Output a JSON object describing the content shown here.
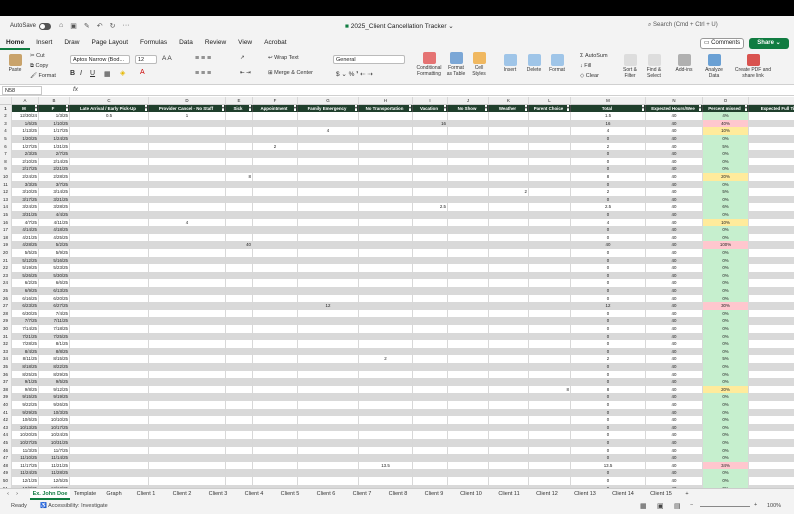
{
  "app": {
    "autosave": "AutoSave",
    "title": "2025_Client Cancellation Tracker",
    "search_placeholder": "Search (Cmd + Ctrl + U)"
  },
  "menu": [
    "Home",
    "Insert",
    "Draw",
    "Page Layout",
    "Formulas",
    "Data",
    "Review",
    "View",
    "Acrobat"
  ],
  "comments_label": "Comments",
  "share_label": "Share",
  "ribbon": {
    "paste": "Paste",
    "cut": "Cut",
    "copy": "Copy",
    "format": "Format",
    "font_name": "Aptos Narrow (Bod...",
    "font_size": "12",
    "wrap_text": "Wrap Text",
    "merge_center": "Merge & Center",
    "number_format": "General",
    "conditional": "Conditional Formatting",
    "format_table": "Format as Table",
    "cell_styles": "Cell Styles",
    "insert": "Insert",
    "delete": "Delete",
    "format2": "Format",
    "autosum": "AutoSum",
    "fill": "Fill",
    "clear": "Clear",
    "sort_filter": "Sort & Filter",
    "find_select": "Find & Select",
    "addins": "Add-ins",
    "analyze": "Analyze Data",
    "create_pdf": "Create PDF and share link"
  },
  "name_box": "N58",
  "fx": "fx",
  "col_letters": [
    "A",
    "B",
    "C",
    "D",
    "E",
    "F",
    "G",
    "H",
    "I",
    "J",
    "K",
    "L",
    "M",
    "N",
    "O",
    ""
  ],
  "headers": [
    "M",
    "F",
    "Late Arrival / Early Pick-Up",
    "Provider Cancel - No Staff",
    "Sick",
    "Appointment",
    "Family Emergency",
    "No Transportation",
    "Vacation",
    "No Show",
    "Weather",
    "Parent Choice",
    "Total",
    "Expected Hours/Wee",
    "Percent missed",
    "Expected Full Ti"
  ],
  "rows": [
    {
      "n": "2",
      "a": "12/30/24",
      "b": "1/3/25",
      "c": "0.5",
      "d": "1",
      "e": "",
      "g": "",
      "h": "",
      "i": "",
      "k": "",
      "l": "",
      "total": "1.5",
      "exp": "40",
      "pct": "4%",
      "lvl": "g"
    },
    {
      "n": "3",
      "a": "1/6/25",
      "b": "1/10/25",
      "c": "",
      "d": "",
      "e": "",
      "g": "",
      "h": "",
      "i": "16",
      "k": "",
      "l": "",
      "total": "16",
      "exp": "40",
      "pct": "40%",
      "lvl": "r"
    },
    {
      "n": "4",
      "a": "1/13/25",
      "b": "1/17/25",
      "c": "",
      "d": "",
      "e": "",
      "g": "4",
      "h": "",
      "i": "",
      "k": "",
      "l": "",
      "total": "4",
      "exp": "40",
      "pct": "10%",
      "lvl": "y"
    },
    {
      "n": "5",
      "a": "1/20/25",
      "b": "1/24/25",
      "c": "",
      "d": "",
      "e": "",
      "g": "",
      "h": "",
      "i": "",
      "k": "",
      "l": "",
      "total": "0",
      "exp": "40",
      "pct": "0%",
      "lvl": "g"
    },
    {
      "n": "6",
      "a": "1/27/25",
      "b": "1/31/25",
      "c": "",
      "d": "",
      "e": "",
      "f": "2",
      "g": "",
      "h": "",
      "i": "",
      "k": "",
      "l": "",
      "total": "2",
      "exp": "40",
      "pct": "5%",
      "lvl": "g"
    },
    {
      "n": "7",
      "a": "2/3/25",
      "b": "2/7/25",
      "total": "0",
      "exp": "40",
      "pct": "0%",
      "lvl": "g"
    },
    {
      "n": "8",
      "a": "2/10/25",
      "b": "2/14/25",
      "total": "0",
      "exp": "40",
      "pct": "0%",
      "lvl": "g"
    },
    {
      "n": "9",
      "a": "2/17/25",
      "b": "2/21/25",
      "total": "0",
      "exp": "40",
      "pct": "0%",
      "lvl": "g"
    },
    {
      "n": "10",
      "a": "2/24/25",
      "b": "2/28/25",
      "e": "8",
      "total": "8",
      "exp": "40",
      "pct": "20%",
      "lvl": "y"
    },
    {
      "n": "11",
      "a": "3/3/25",
      "b": "3/7/25",
      "total": "0",
      "exp": "40",
      "pct": "0%",
      "lvl": "g"
    },
    {
      "n": "12",
      "a": "3/10/25",
      "b": "3/14/25",
      "k": "2",
      "total": "2",
      "exp": "40",
      "pct": "5%",
      "lvl": "g"
    },
    {
      "n": "13",
      "a": "3/17/25",
      "b": "3/21/25",
      "total": "0",
      "exp": "40",
      "pct": "0%",
      "lvl": "g"
    },
    {
      "n": "14",
      "a": "3/24/25",
      "b": "3/28/25",
      "i": "2.5",
      "total": "2.5",
      "exp": "40",
      "pct": "6%",
      "lvl": "g"
    },
    {
      "n": "15",
      "a": "3/31/25",
      "b": "4/4/25",
      "total": "0",
      "exp": "40",
      "pct": "0%",
      "lvl": "g"
    },
    {
      "n": "16",
      "a": "4/7/25",
      "b": "4/11/25",
      "d": "4",
      "total": "4",
      "exp": "40",
      "pct": "10%",
      "lvl": "y"
    },
    {
      "n": "17",
      "a": "4/14/25",
      "b": "4/18/25",
      "total": "0",
      "exp": "40",
      "pct": "0%",
      "lvl": "g"
    },
    {
      "n": "18",
      "a": "4/21/25",
      "b": "4/25/25",
      "total": "0",
      "exp": "40",
      "pct": "0%",
      "lvl": "g"
    },
    {
      "n": "19",
      "a": "4/28/25",
      "b": "5/2/25",
      "e": "40",
      "total": "40",
      "exp": "40",
      "pct": "100%",
      "lvl": "r"
    },
    {
      "n": "20",
      "a": "5/5/25",
      "b": "5/9/25",
      "total": "0",
      "exp": "40",
      "pct": "0%",
      "lvl": "g"
    },
    {
      "n": "21",
      "a": "5/12/25",
      "b": "5/16/25",
      "total": "0",
      "exp": "40",
      "pct": "0%",
      "lvl": "g"
    },
    {
      "n": "22",
      "a": "5/19/25",
      "b": "5/23/25",
      "total": "0",
      "exp": "40",
      "pct": "0%",
      "lvl": "g"
    },
    {
      "n": "23",
      "a": "5/26/25",
      "b": "5/30/25",
      "total": "0",
      "exp": "40",
      "pct": "0%",
      "lvl": "g"
    },
    {
      "n": "24",
      "a": "6/2/25",
      "b": "6/6/25",
      "total": "0",
      "exp": "40",
      "pct": "0%",
      "lvl": "g"
    },
    {
      "n": "25",
      "a": "6/9/25",
      "b": "6/13/25",
      "total": "0",
      "exp": "40",
      "pct": "0%",
      "lvl": "g"
    },
    {
      "n": "26",
      "a": "6/16/25",
      "b": "6/20/25",
      "total": "0",
      "exp": "40",
      "pct": "0%",
      "lvl": "g"
    },
    {
      "n": "27",
      "a": "6/23/25",
      "b": "6/27/25",
      "g": "12",
      "total": "12",
      "exp": "40",
      "pct": "30%",
      "lvl": "r"
    },
    {
      "n": "28",
      "a": "6/30/25",
      "b": "7/4/25",
      "total": "0",
      "exp": "40",
      "pct": "0%",
      "lvl": "g"
    },
    {
      "n": "29",
      "a": "7/7/25",
      "b": "7/11/25",
      "total": "0",
      "exp": "40",
      "pct": "0%",
      "lvl": "g"
    },
    {
      "n": "30",
      "a": "7/14/25",
      "b": "7/18/25",
      "total": "0",
      "exp": "40",
      "pct": "0%",
      "lvl": "g"
    },
    {
      "n": "31",
      "a": "7/21/25",
      "b": "7/25/25",
      "total": "0",
      "exp": "40",
      "pct": "0%",
      "lvl": "g"
    },
    {
      "n": "32",
      "a": "7/28/25",
      "b": "8/1/25",
      "total": "0",
      "exp": "40",
      "pct": "0%",
      "lvl": "g"
    },
    {
      "n": "33",
      "a": "8/4/25",
      "b": "8/8/25",
      "total": "0",
      "exp": "40",
      "pct": "0%",
      "lvl": "g"
    },
    {
      "n": "34",
      "a": "8/11/25",
      "b": "8/15/25",
      "h": "2",
      "total": "2",
      "exp": "40",
      "pct": "5%",
      "lvl": "g"
    },
    {
      "n": "35",
      "a": "8/18/25",
      "b": "8/22/25",
      "total": "0",
      "exp": "40",
      "pct": "0%",
      "lvl": "g"
    },
    {
      "n": "36",
      "a": "8/25/25",
      "b": "8/29/25",
      "total": "0",
      "exp": "40",
      "pct": "0%",
      "lvl": "g"
    },
    {
      "n": "37",
      "a": "9/1/25",
      "b": "9/5/25",
      "total": "0",
      "exp": "40",
      "pct": "0%",
      "lvl": "g"
    },
    {
      "n": "38",
      "a": "9/8/25",
      "b": "9/12/25",
      "l": "8",
      "total": "8",
      "exp": "40",
      "pct": "20%",
      "lvl": "y"
    },
    {
      "n": "39",
      "a": "9/15/25",
      "b": "9/19/25",
      "total": "0",
      "exp": "40",
      "pct": "0%",
      "lvl": "g"
    },
    {
      "n": "40",
      "a": "9/22/25",
      "b": "9/26/25",
      "total": "0",
      "exp": "40",
      "pct": "0%",
      "lvl": "g"
    },
    {
      "n": "41",
      "a": "9/29/25",
      "b": "10/3/25",
      "total": "0",
      "exp": "40",
      "pct": "0%",
      "lvl": "g"
    },
    {
      "n": "42",
      "a": "10/6/25",
      "b": "10/10/25",
      "total": "0",
      "exp": "40",
      "pct": "0%",
      "lvl": "g"
    },
    {
      "n": "43",
      "a": "10/13/25",
      "b": "10/17/25",
      "total": "0",
      "exp": "40",
      "pct": "0%",
      "lvl": "g"
    },
    {
      "n": "44",
      "a": "10/20/25",
      "b": "10/24/25",
      "total": "0",
      "exp": "40",
      "pct": "0%",
      "lvl": "g"
    },
    {
      "n": "45",
      "a": "10/27/25",
      "b": "10/31/25",
      "total": "0",
      "exp": "40",
      "pct": "0%",
      "lvl": "g"
    },
    {
      "n": "46",
      "a": "11/3/25",
      "b": "11/7/25",
      "total": "0",
      "exp": "40",
      "pct": "0%",
      "lvl": "g"
    },
    {
      "n": "47",
      "a": "11/10/25",
      "b": "11/14/25",
      "total": "0",
      "exp": "40",
      "pct": "0%",
      "lvl": "g"
    },
    {
      "n": "48",
      "a": "11/17/25",
      "b": "11/21/25",
      "h": "13.5",
      "total": "13.5",
      "exp": "40",
      "pct": "34%",
      "lvl": "r"
    },
    {
      "n": "49",
      "a": "11/24/25",
      "b": "11/28/25",
      "total": "0",
      "exp": "40",
      "pct": "0%",
      "lvl": "g"
    },
    {
      "n": "50",
      "a": "12/1/25",
      "b": "12/5/25",
      "total": "0",
      "exp": "40",
      "pct": "0%",
      "lvl": "g"
    },
    {
      "n": "51",
      "a": "12/8/25",
      "b": "12/12/25",
      "total": "0",
      "exp": "40",
      "pct": "0%",
      "lvl": "g"
    }
  ],
  "sheet_tabs": [
    "Ex. John Doe",
    "Template",
    "Graph",
    "Client 1",
    "Client 2",
    "Client 3",
    "Client 4",
    "Client 5",
    "Client 6",
    "Client 7",
    "Client 8",
    "Client 9",
    "Client 10",
    "Client 11",
    "Client 12",
    "Client 13",
    "Client 14",
    "Client 15",
    "+"
  ],
  "status": {
    "ready": "Ready",
    "accessibility": "Accessibility: Investigate",
    "zoom": "100%"
  },
  "colors": {
    "accent": "#107c41",
    "header_fill": "#1f3f2c",
    "band": "#d9d9d9",
    "pct_green": "#c6efce",
    "pct_yellow": "#ffeb9c",
    "pct_red": "#ffc7ce"
  }
}
